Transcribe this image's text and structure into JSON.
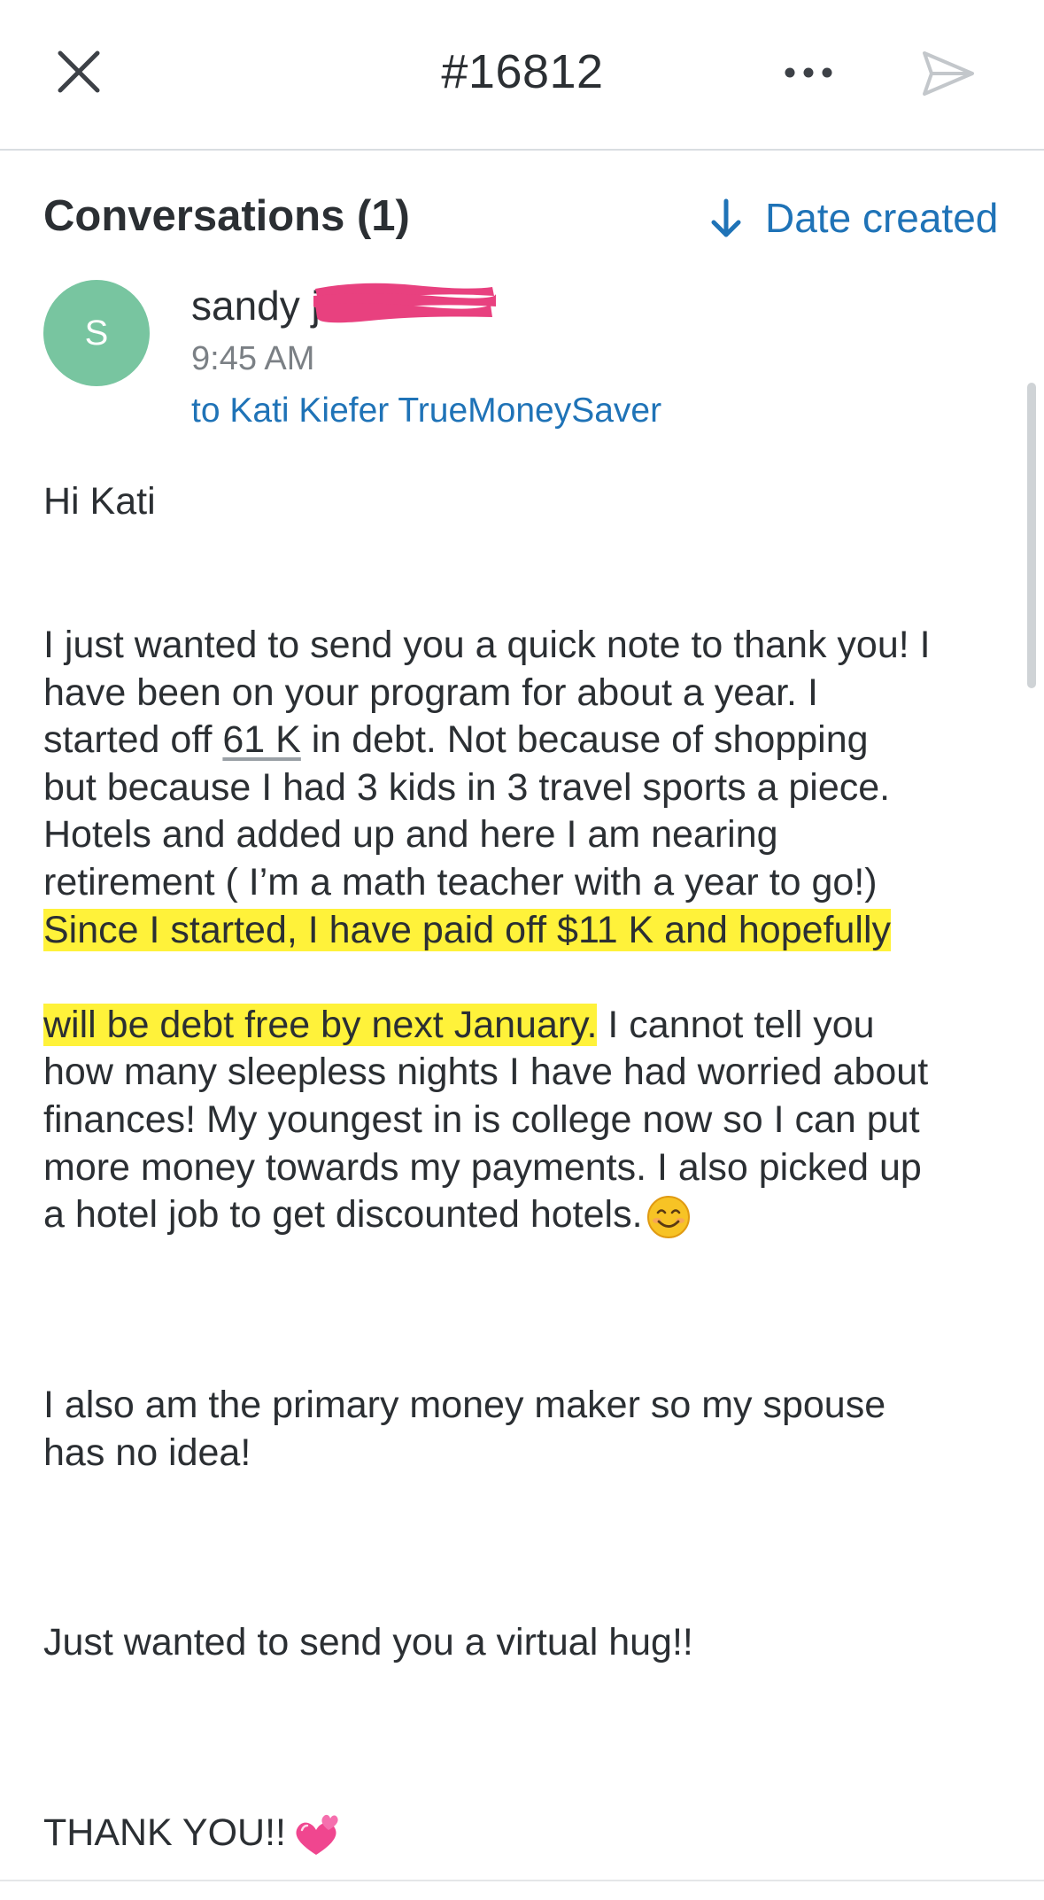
{
  "header": {
    "ticket_number": "#16812",
    "close_icon": "close-icon",
    "more_icon": "more-horizontal-icon",
    "send_icon": "send-icon"
  },
  "conversations": {
    "title": "Conversations (1)",
    "sort_label": "Date created",
    "sort_icon": "arrow-down-icon"
  },
  "message": {
    "avatar_initial": "S",
    "sender": "sandy j",
    "time": "9:45 AM",
    "recipient": "to Kati Kiefer TrueMoneySaver",
    "greeting": "Hi Kati",
    "para1": {
      "l1": "I just wanted to send you a quick note to thank you! I",
      "l2": "have been on your program for about a year. I",
      "l3_pre": "started off ",
      "l3_amount": "61 K",
      "l3_post": " in debt. Not because of shopping",
      "l4": "but because I had 3 kids in 3 travel sports a piece.",
      "l5": "Hotels and added up and here I am nearing",
      "l6": "retirement ( I’m a math teacher with a year to go!)",
      "l7_highlight": "Since I started, I have paid off $11 K and hopefully ",
      "l8_highlight": "will be debt free by next January.",
      "l8_rest": " I cannot tell you",
      "l9": "how many sleepless nights I have had worried about",
      "l10": "finances! My youngest in is college now so I can put",
      "l11": "more money towards my payments. I also picked up",
      "l12": "a hotel job to get discounted hotels."
    },
    "para2": {
      "l1": "I also am the primary money maker so my spouse",
      "l2": "has no idea!"
    },
    "para3": "Just wanted to send you a virtual hug!!",
    "para4": "THANK YOU!!",
    "emoji_smile": "smiling-face-emoji",
    "emoji_hearts": "two-hearts-emoji"
  },
  "colors": {
    "accent": "#1f73b7",
    "avatar": "#78c5a0",
    "highlight": "#fff23a",
    "redaction": "#e8417f"
  }
}
